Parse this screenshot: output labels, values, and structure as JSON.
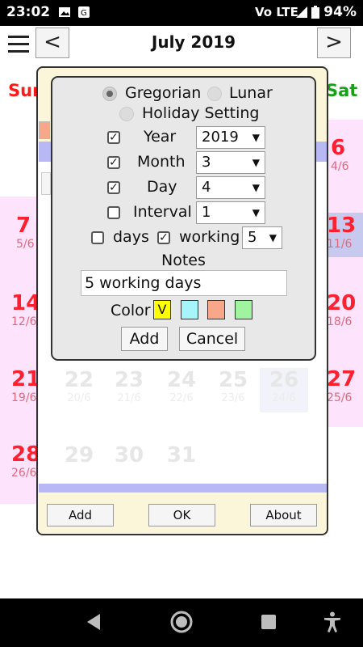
{
  "status_bar": {
    "time": "23:02",
    "battery_percent": "94%",
    "network": "Vo LTE"
  },
  "header": {
    "title": "July 2019",
    "prev_label": "<",
    "next_label": ">"
  },
  "calendar": {
    "day_headers": {
      "sunday": "Sun",
      "saturday": "Sat"
    },
    "sunday_cells": [
      {
        "day": "7",
        "sub": "5/6"
      },
      {
        "day": "14",
        "sub": "12/6"
      },
      {
        "day": "21",
        "sub": "19/6"
      },
      {
        "day": "28",
        "sub": "26/6"
      }
    ],
    "saturday_cells": [
      {
        "day": "6",
        "sub": "4/6"
      },
      {
        "day": "13",
        "sub": "11/6"
      },
      {
        "day": "20",
        "sub": "18/6"
      },
      {
        "day": "27",
        "sub": "25/6"
      }
    ],
    "faded_row_week4": [
      {
        "day": "22",
        "sub": "20/6"
      },
      {
        "day": "23",
        "sub": "21/6"
      },
      {
        "day": "24",
        "sub": "22/6"
      },
      {
        "day": "25",
        "sub": "23/6"
      },
      {
        "day": "26",
        "sub": "24/6"
      }
    ],
    "faded_row_week5": [
      {
        "day": "29"
      },
      {
        "day": "30"
      },
      {
        "day": "31"
      }
    ]
  },
  "dialog": {
    "add_label": "Add",
    "ok_label": "OK",
    "about_label": "About"
  },
  "popup": {
    "calendar_type": {
      "gregorian_label": "Gregorian",
      "lunar_label": "Lunar",
      "holiday_label": "Holiday Setting",
      "selected": "Gregorian"
    },
    "year": {
      "label": "Year",
      "checked": true,
      "value": "2019"
    },
    "month": {
      "label": "Month",
      "checked": true,
      "value": "3"
    },
    "day": {
      "label": "Day",
      "checked": true,
      "value": "4"
    },
    "interval": {
      "label": "Interval",
      "checked": false,
      "value": "1"
    },
    "days": {
      "label": "days",
      "checked": false
    },
    "working": {
      "label": "working",
      "checked": true,
      "value": "5"
    },
    "notes_label": "Notes",
    "notes_value": "5 working days",
    "color_label": "Color",
    "colors": [
      {
        "hex": "#ffff00",
        "mark": "V"
      },
      {
        "hex": "#a8f4fb",
        "mark": ""
      },
      {
        "hex": "#f8a888",
        "mark": ""
      },
      {
        "hex": "#a0f4a0",
        "mark": ""
      }
    ],
    "add_label": "Add",
    "cancel_label": "Cancel"
  }
}
